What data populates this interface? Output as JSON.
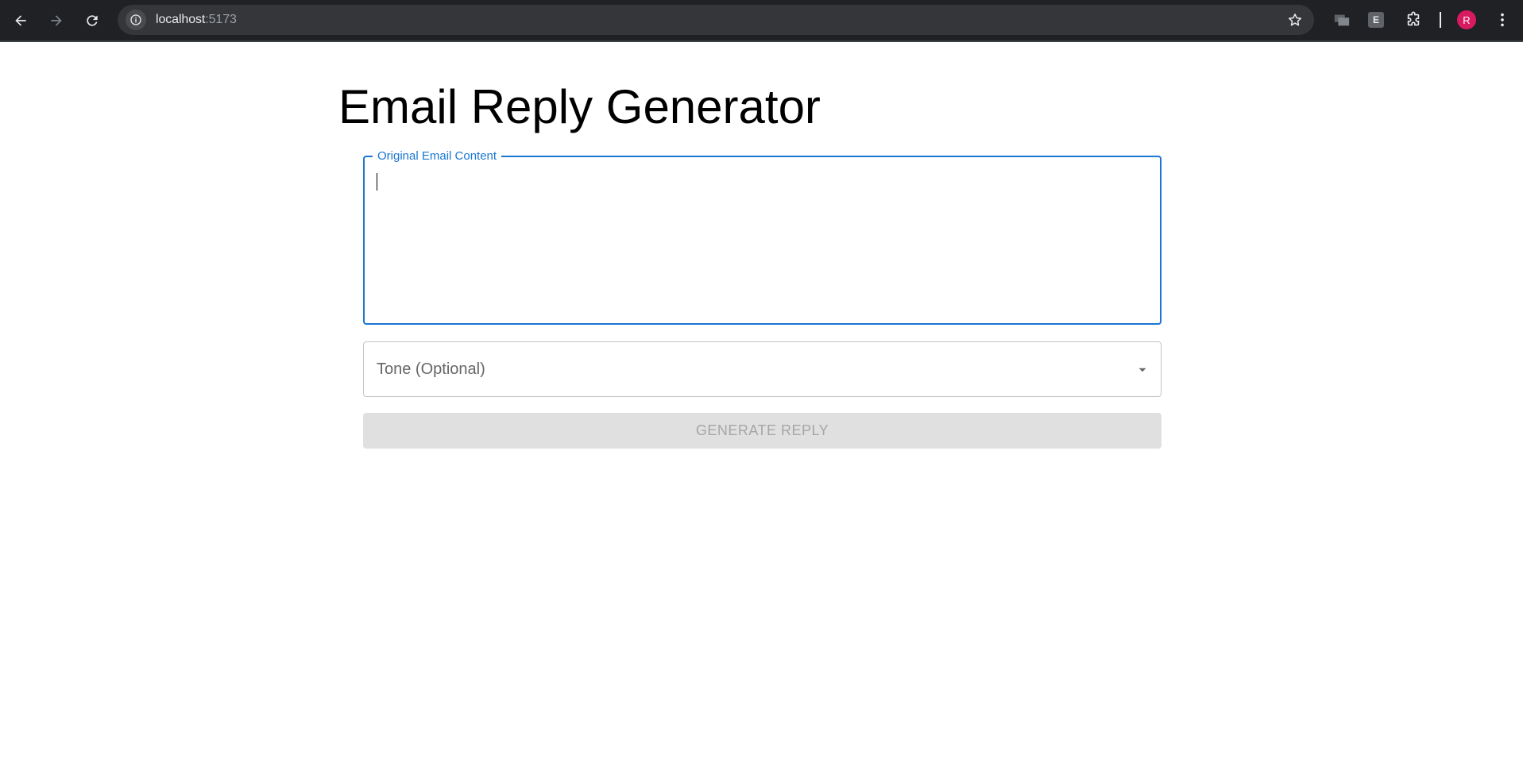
{
  "browser": {
    "url_host": "localhost",
    "url_port": ":5173",
    "avatar_initial": "R",
    "extension_e_label": "E",
    "accent_avatar_color": "#d81b60"
  },
  "icons": {
    "back": "arrow-left-icon",
    "forward": "arrow-right-icon",
    "reload": "reload-icon",
    "site_info": "info-icon",
    "bookmark": "star-icon",
    "tab_search": "tabs-icon",
    "extensions": "puzzle-icon",
    "menu": "more-vertical-icon",
    "dropdown": "caret-down-icon"
  },
  "main": {
    "title": "Email Reply Generator",
    "email_field": {
      "label": "Original Email Content",
      "value": "",
      "focused": true
    },
    "tone_select": {
      "label": "Tone (Optional)",
      "selected": ""
    },
    "generate_button": {
      "label": "GENERATE REPLY",
      "disabled": true
    }
  },
  "colors": {
    "primary": "#1976d2",
    "disabled_bg": "#e0e0e0",
    "disabled_text": "#a6a6a6"
  }
}
